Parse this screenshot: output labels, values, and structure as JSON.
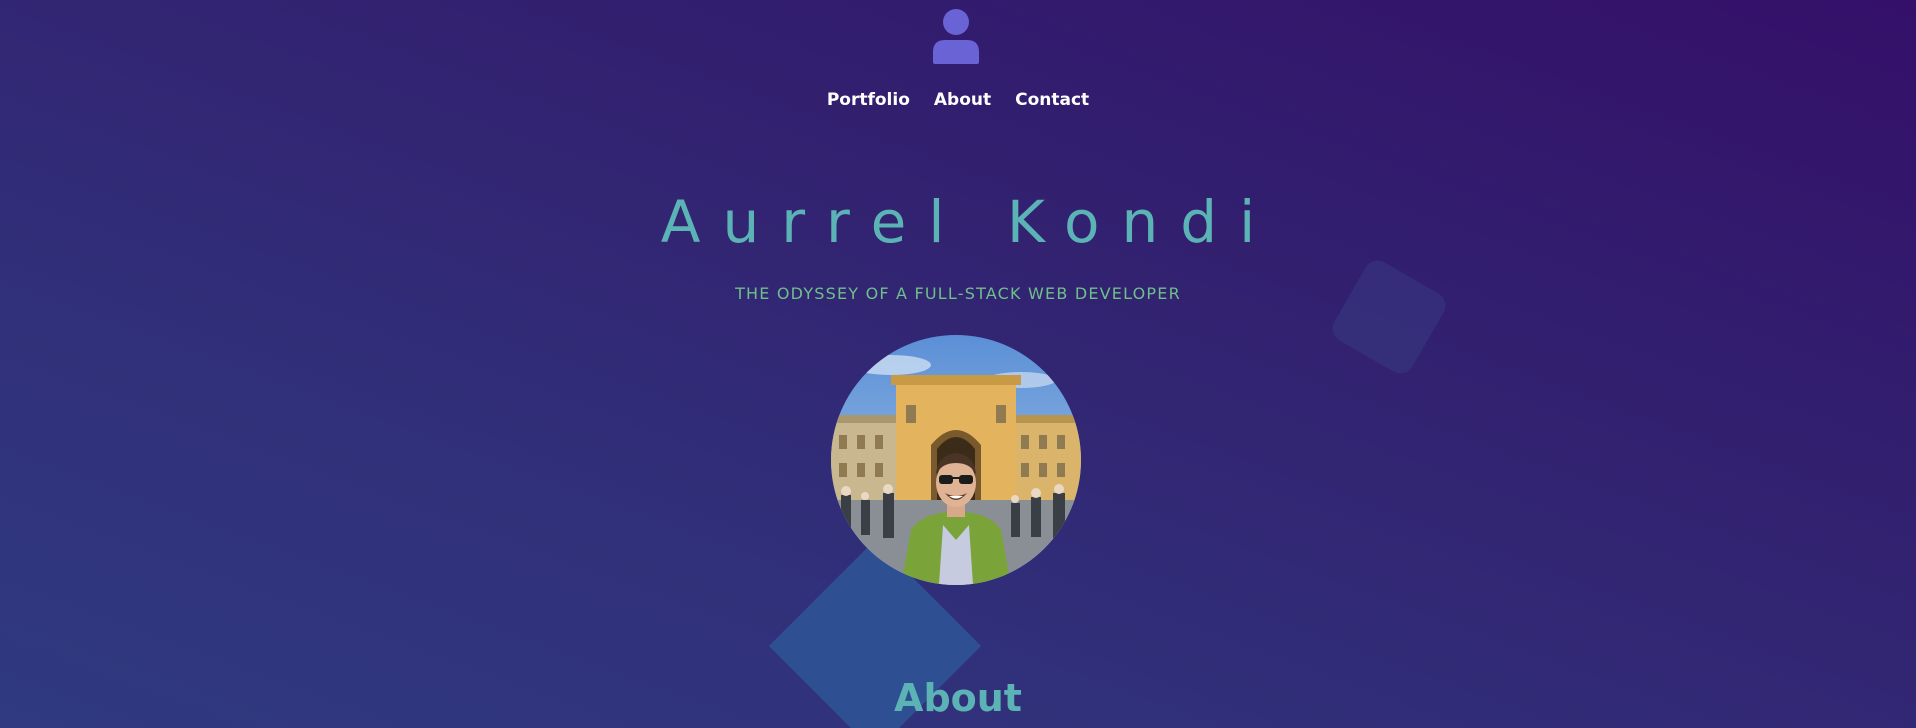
{
  "header": {
    "icon": "user-icon",
    "icon_color": "#6a63d6"
  },
  "nav": {
    "items": [
      {
        "label": "Portfolio"
      },
      {
        "label": "About"
      },
      {
        "label": "Contact"
      }
    ]
  },
  "hero": {
    "name": "Aurrel Kondi",
    "tagline": "THE ODYSSEY OF A FULL-STACK WEB DEVELOPER",
    "photo": "profile-photo"
  },
  "sections": {
    "about_heading": "About"
  },
  "colors": {
    "background_top": "#34106a",
    "background_bottom": "#2f3a80",
    "accent_teal": "#5cb3b5",
    "accent_green": "#6ec08a",
    "diamond": "#2e5596"
  }
}
